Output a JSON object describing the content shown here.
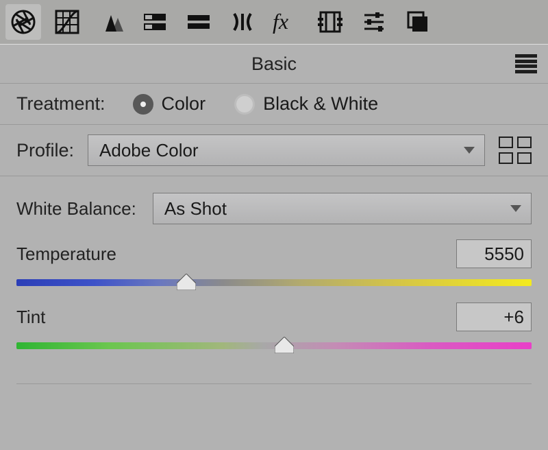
{
  "toolbar": {
    "icons": [
      "aperture-icon",
      "curve-icon",
      "detail-icon",
      "hsl-icon",
      "split-icon",
      "lens-icon",
      "fx-icon",
      "film-icon",
      "presets-icon",
      "snapshots-icon"
    ]
  },
  "panel": {
    "title": "Basic"
  },
  "treatment": {
    "label": "Treatment:",
    "options": [
      {
        "label": "Color",
        "selected": true
      },
      {
        "label": "Black & White",
        "selected": false
      }
    ]
  },
  "profile": {
    "label": "Profile:",
    "selected": "Adobe Color"
  },
  "whiteBalance": {
    "label": "White Balance:",
    "selected": "As Shot"
  },
  "temperature": {
    "label": "Temperature",
    "value": "5550",
    "thumb_pct": 33
  },
  "tint": {
    "label": "Tint",
    "value": "+6",
    "thumb_pct": 52
  }
}
